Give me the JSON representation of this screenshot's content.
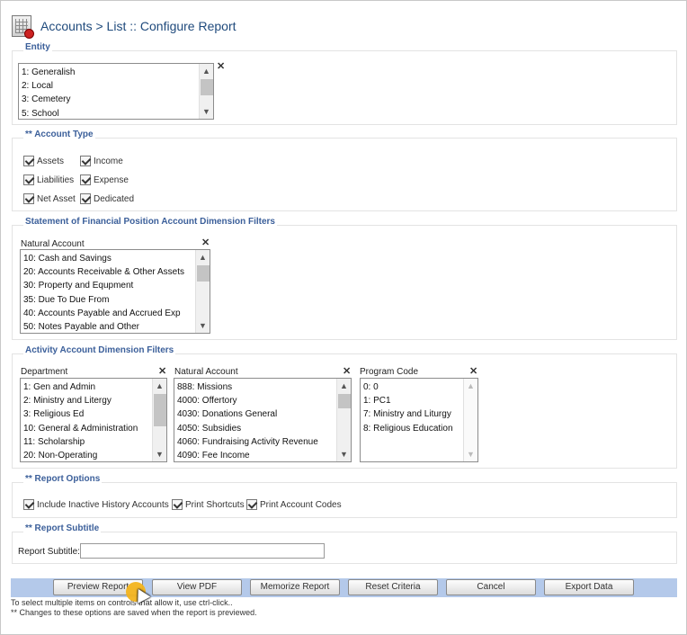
{
  "header": {
    "title": "Accounts > List :: Configure Report",
    "icon": "report-config-icon"
  },
  "entity": {
    "legend": "Entity",
    "items": [
      "1: Generalish",
      "2: Local",
      "3: Cemetery",
      "5: School"
    ],
    "clear": "✕"
  },
  "account_type": {
    "legend": "** Account Type",
    "options": [
      "Assets",
      "Income",
      "Liabilities",
      "Expense",
      "Net Asset",
      "Dedicated"
    ]
  },
  "sofp": {
    "legend": "Statement of Financial Position Account Dimension Filters",
    "natural_account_label": "Natural Account",
    "natural_account_items": [
      "10: Cash and Savings",
      "20: Accounts Receivable & Other Assets",
      "30: Property and Equpment",
      "35: Due To Due From",
      "40: Accounts Payable and Accrued Exp",
      "50: Notes Payable and Other"
    ],
    "clear": "✕"
  },
  "activity": {
    "legend": "Activity Account Dimension Filters",
    "department_label": "Department",
    "department_items": [
      "1: Gen and Admin",
      "2: Ministry and Litergy",
      "3: Religious Ed",
      "10: General & Administration",
      "11: Scholarship",
      "20: Non-Operating"
    ],
    "natural_account_label": "Natural Account",
    "natural_account_items": [
      "888: Missions",
      "4000: Offertory",
      "4030: Donations General",
      "4050: Subsidies",
      "4060: Fundraising Activity Revenue",
      "4090: Fee Income"
    ],
    "program_code_label": "Program Code",
    "program_code_items": [
      "0: 0",
      "1: PC1",
      "7: Ministry and Liturgy",
      "8: Religious Education"
    ],
    "clear": "✕"
  },
  "report_options": {
    "legend": "** Report Options",
    "options": [
      "Include Inactive History Accounts",
      "Print Shortcuts",
      "Print Account Codes"
    ]
  },
  "report_subtitle": {
    "legend": "** Report Subtitle",
    "label": "Report Subtitle:",
    "value": ""
  },
  "buttons": {
    "preview": "Preview Report",
    "view_pdf": "View PDF",
    "memorize": "Memorize Report",
    "reset": "Reset Criteria",
    "cancel": "Cancel",
    "export": "Export Data"
  },
  "notes": {
    "line1": "To select multiple items on controls that allow it, use ctrl-click..",
    "line2": "** Changes to these options are saved when the report is previewed."
  },
  "colors": {
    "accent": "#3b5f9a",
    "title": "#1f4a7c",
    "button_bar": "#b4c9ea",
    "cursor_highlight": "#f3b41d"
  }
}
